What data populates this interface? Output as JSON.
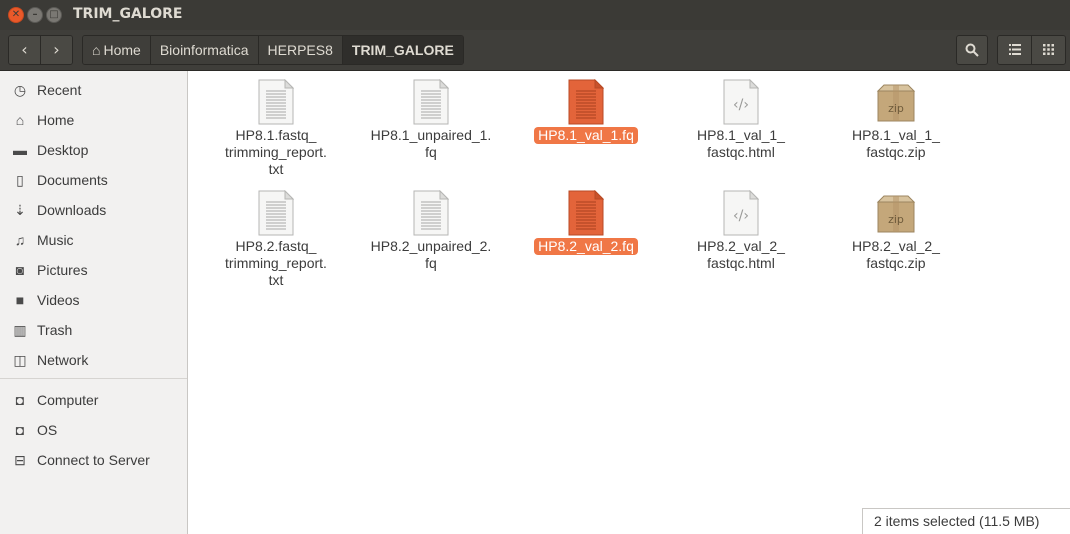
{
  "window": {
    "title": "TRIM_GALORE"
  },
  "toolbar": {
    "breadcrumbs": [
      "Home",
      "Bioinformatica",
      "HERPES8",
      "TRIM_GALORE"
    ]
  },
  "sidebar": {
    "items": [
      {
        "label": "Recent",
        "icon": "clock-icon"
      },
      {
        "label": "Home",
        "icon": "home-icon"
      },
      {
        "label": "Desktop",
        "icon": "folder-icon"
      },
      {
        "label": "Documents",
        "icon": "document-icon"
      },
      {
        "label": "Downloads",
        "icon": "download-icon"
      },
      {
        "label": "Music",
        "icon": "music-icon"
      },
      {
        "label": "Pictures",
        "icon": "camera-icon"
      },
      {
        "label": "Videos",
        "icon": "video-icon"
      },
      {
        "label": "Trash",
        "icon": "trash-icon"
      },
      {
        "label": "Network",
        "icon": "network-icon"
      }
    ],
    "devices": [
      {
        "label": "Computer",
        "icon": "drive-icon"
      },
      {
        "label": "OS",
        "icon": "drive-icon"
      },
      {
        "label": "Connect to Server",
        "icon": "server-icon"
      }
    ]
  },
  "files": [
    {
      "lines": [
        "HP8.1.fastq_",
        "trimming_report.",
        "txt"
      ],
      "type": "text",
      "selected": false
    },
    {
      "lines": [
        "HP8.1_unpaired_1.",
        "fq"
      ],
      "type": "text",
      "selected": false
    },
    {
      "lines": [
        "HP8.1_val_1.fq"
      ],
      "type": "text",
      "selected": true
    },
    {
      "lines": [
        "HP8.1_val_1_",
        "fastqc.html"
      ],
      "type": "html",
      "selected": false
    },
    {
      "lines": [
        "HP8.1_val_1_",
        "fastqc.zip"
      ],
      "type": "zip",
      "selected": false
    },
    {
      "lines": [
        "HP8.2.fastq_",
        "trimming_report.",
        "txt"
      ],
      "type": "text",
      "selected": false
    },
    {
      "lines": [
        "HP8.2_unpaired_2.",
        "fq"
      ],
      "type": "text",
      "selected": false
    },
    {
      "lines": [
        "HP8.2_val_2.fq"
      ],
      "type": "text",
      "selected": true
    },
    {
      "lines": [
        "HP8.2_val_2_",
        "fastqc.html"
      ],
      "type": "html",
      "selected": false
    },
    {
      "lines": [
        "HP8.2_val_2_",
        "fastqc.zip"
      ],
      "type": "zip",
      "selected": false
    }
  ],
  "zip_label": "zip",
  "status": {
    "text": "2 items selected  (11.5 MB)"
  },
  "colors": {
    "selection": "#f07746",
    "titlebar": "#3b3a36",
    "close": "#e9592a"
  }
}
